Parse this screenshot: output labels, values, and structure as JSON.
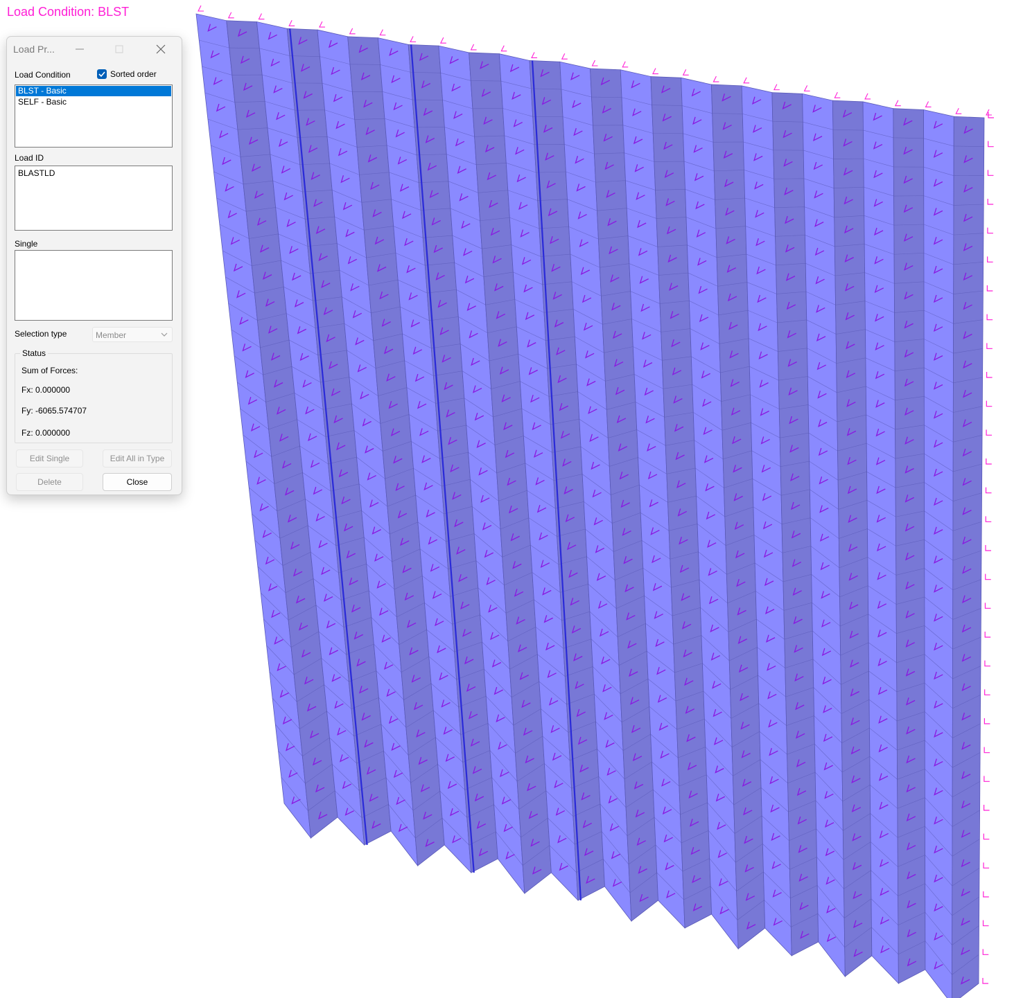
{
  "viewport": {
    "title": "Load Condition: BLST",
    "colors": {
      "panel_light": "#8a8aff",
      "panel_dark": "#7878d6",
      "edge": "#5a5ab8",
      "load_arrow": "#8a18e0",
      "label_magenta": "#ff1fd6"
    }
  },
  "dialog": {
    "title": "Load Pr...",
    "minimize_icon": "minimize-icon",
    "maximize_icon": "maximize-icon",
    "close_icon": "close-icon",
    "load_condition_label": "Load Condition",
    "sorted_order_label": "Sorted order",
    "sorted_order_checked": true,
    "load_conditions": [
      "BLST - Basic",
      "SELF - Basic"
    ],
    "selected_load_condition": "BLST - Basic",
    "load_id_label": "Load ID",
    "load_ids": [
      "BLASTLD"
    ],
    "single_label": "Single",
    "single_items": [],
    "selection_type_label": "Selection type",
    "selection_type_value": "Member",
    "status_label": "Status",
    "sum_of_forces_label": "Sum of Forces:",
    "fx": "Fx: 0.000000",
    "fy": "Fy: -6065.574707",
    "fz": "Fz: 0.000000",
    "edit_single_label": "Edit Single",
    "edit_all_label": "Edit All in Type",
    "delete_label": "Delete",
    "close_label": "Close"
  }
}
